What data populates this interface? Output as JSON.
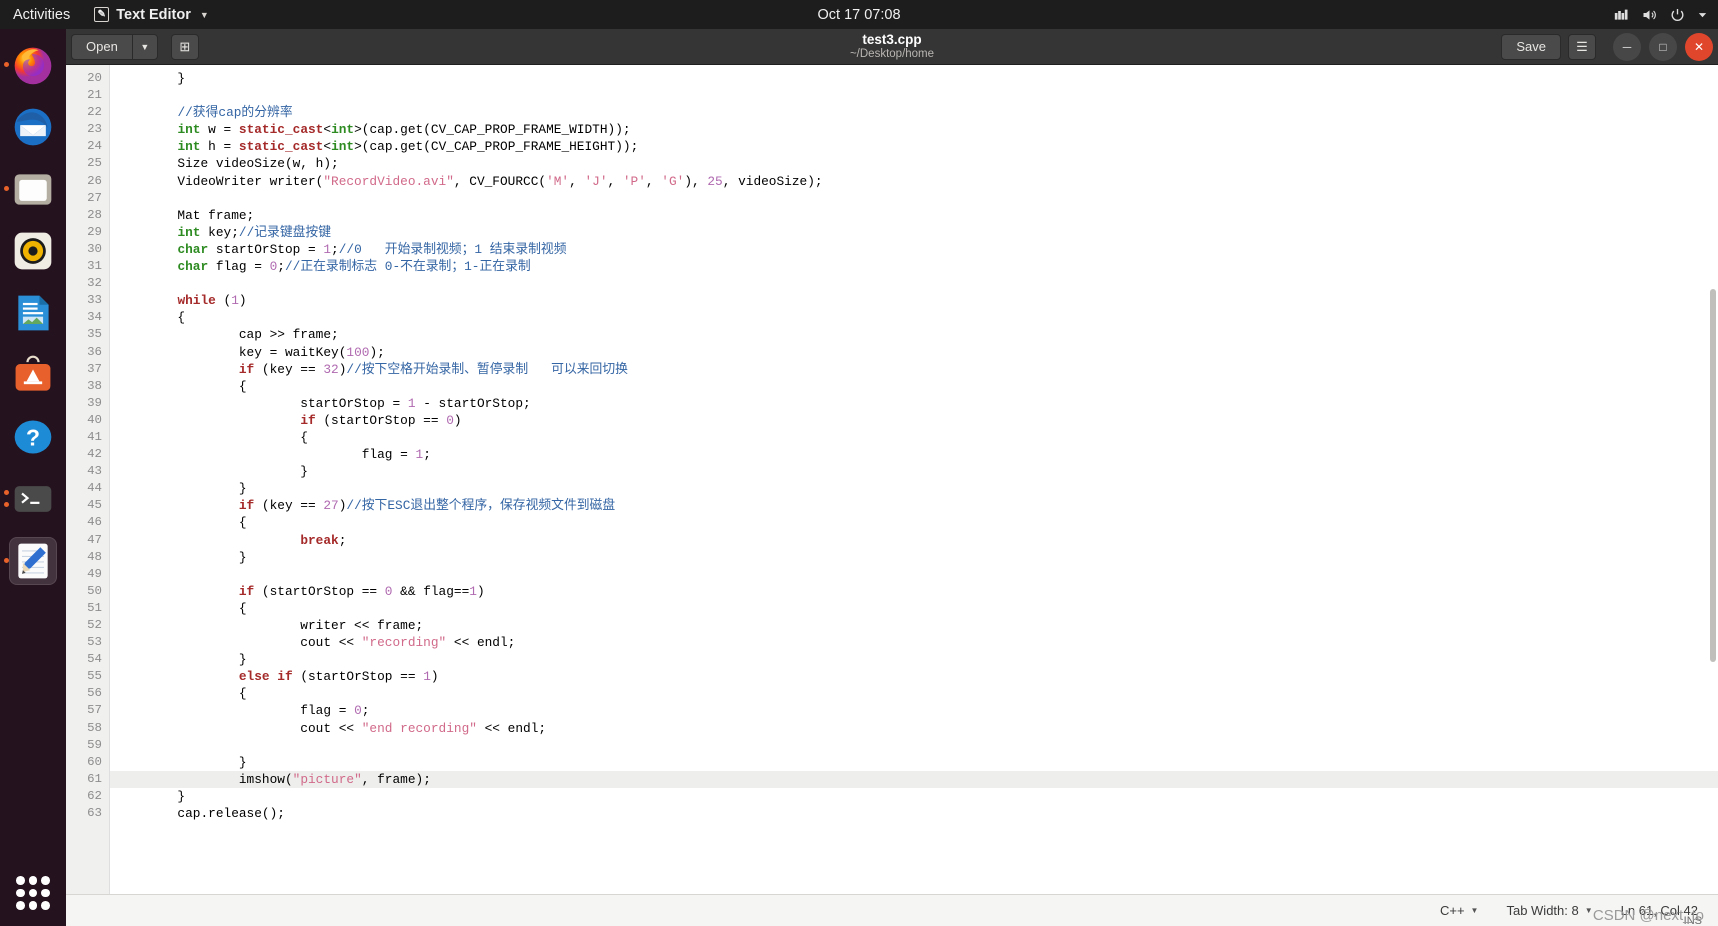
{
  "topbar": {
    "activities": "Activities",
    "app_name": "Text Editor",
    "app_icon": "pencil-icon",
    "dropdown_icon": "chevron-down-icon",
    "clock": "Oct 17  07:08",
    "indicators": [
      "network-icon",
      "volume-icon",
      "power-icon",
      "chevron-down-icon"
    ]
  },
  "dock": {
    "items": [
      {
        "name": "firefox",
        "running": true
      },
      {
        "name": "thunderbird",
        "running": false
      },
      {
        "name": "files",
        "running": true
      },
      {
        "name": "rhythmbox",
        "running": false
      },
      {
        "name": "libreoffice-writer",
        "running": false
      },
      {
        "name": "ubuntu-software",
        "running": false
      },
      {
        "name": "help",
        "running": false
      },
      {
        "name": "terminal",
        "running": true
      },
      {
        "name": "text-editor",
        "running": true,
        "active": true
      }
    ],
    "show_applications": "show-applications-icon"
  },
  "window": {
    "open_label": "Open",
    "open_dropdown_icon": "chevron-down-icon",
    "new_document_icon": "new-document-icon",
    "title": "test3.cpp",
    "subtitle": "~/Desktop/home",
    "save_label": "Save",
    "menu_icon": "hamburger-menu-icon",
    "minimize_icon": "minimize-icon",
    "maximize_icon": "maximize-icon",
    "close_icon": "close-icon"
  },
  "statusbar": {
    "language": "C++",
    "language_arrow": "chevron-down-icon",
    "tab_width": "Tab Width: 8",
    "tab_width_arrow": "chevron-down-icon",
    "position": "Ln 61, Col 42",
    "insert_mode": "INS",
    "watermark": "CSDN @next_to"
  },
  "editor": {
    "first_line": 20,
    "current_line": 61,
    "lines": [
      {
        "n": 20,
        "tokens": [
          {
            "t": "        }"
          }
        ]
      },
      {
        "n": 21,
        "tokens": [
          {
            "t": ""
          }
        ]
      },
      {
        "n": 22,
        "tokens": [
          {
            "t": "        "
          },
          {
            "t": "//获得cap的分辨率",
            "c": "com"
          }
        ]
      },
      {
        "n": 23,
        "tokens": [
          {
            "t": "        "
          },
          {
            "t": "int",
            "c": "typ"
          },
          {
            "t": " w = "
          },
          {
            "t": "static_cast",
            "c": "kw"
          },
          {
            "t": "<"
          },
          {
            "t": "int",
            "c": "typ"
          },
          {
            "t": ">(cap.get(CV_CAP_PROP_FRAME_WIDTH));"
          }
        ]
      },
      {
        "n": 24,
        "tokens": [
          {
            "t": "        "
          },
          {
            "t": "int",
            "c": "typ"
          },
          {
            "t": " h = "
          },
          {
            "t": "static_cast",
            "c": "kw"
          },
          {
            "t": "<"
          },
          {
            "t": "int",
            "c": "typ"
          },
          {
            "t": ">(cap.get(CV_CAP_PROP_FRAME_HEIGHT));"
          }
        ]
      },
      {
        "n": 25,
        "tokens": [
          {
            "t": "        Size videoSize(w, h);"
          }
        ]
      },
      {
        "n": 26,
        "tokens": [
          {
            "t": "        VideoWriter writer("
          },
          {
            "t": "\"RecordVideo.avi\"",
            "c": "str"
          },
          {
            "t": ", CV_FOURCC("
          },
          {
            "t": "'M'",
            "c": "str"
          },
          {
            "t": ", "
          },
          {
            "t": "'J'",
            "c": "str"
          },
          {
            "t": ", "
          },
          {
            "t": "'P'",
            "c": "str"
          },
          {
            "t": ", "
          },
          {
            "t": "'G'",
            "c": "str"
          },
          {
            "t": "), "
          },
          {
            "t": "25",
            "c": "num"
          },
          {
            "t": ", videoSize);"
          }
        ]
      },
      {
        "n": 27,
        "tokens": [
          {
            "t": ""
          }
        ]
      },
      {
        "n": 28,
        "tokens": [
          {
            "t": "        Mat frame;"
          }
        ]
      },
      {
        "n": 29,
        "tokens": [
          {
            "t": "        "
          },
          {
            "t": "int",
            "c": "typ"
          },
          {
            "t": " key;"
          },
          {
            "t": "//记录键盘按键",
            "c": "com"
          }
        ]
      },
      {
        "n": 30,
        "tokens": [
          {
            "t": "        "
          },
          {
            "t": "char",
            "c": "typ"
          },
          {
            "t": " startOrStop = "
          },
          {
            "t": "1",
            "c": "num"
          },
          {
            "t": ";"
          },
          {
            "t": "//0   开始录制视频；1 结束录制视频",
            "c": "com"
          }
        ]
      },
      {
        "n": 31,
        "tokens": [
          {
            "t": "        "
          },
          {
            "t": "char",
            "c": "typ"
          },
          {
            "t": " flag = "
          },
          {
            "t": "0",
            "c": "num"
          },
          {
            "t": ";"
          },
          {
            "t": "//正在录制标志 0-不在录制；1-正在录制",
            "c": "com"
          }
        ]
      },
      {
        "n": 32,
        "tokens": [
          {
            "t": ""
          }
        ]
      },
      {
        "n": 33,
        "tokens": [
          {
            "t": "        "
          },
          {
            "t": "while",
            "c": "kw"
          },
          {
            "t": " ("
          },
          {
            "t": "1",
            "c": "num"
          },
          {
            "t": ")"
          }
        ]
      },
      {
        "n": 34,
        "tokens": [
          {
            "t": "        {"
          }
        ]
      },
      {
        "n": 35,
        "tokens": [
          {
            "t": "                cap >> frame;"
          }
        ]
      },
      {
        "n": 36,
        "tokens": [
          {
            "t": "                key = waitKey("
          },
          {
            "t": "100",
            "c": "num"
          },
          {
            "t": ");"
          }
        ]
      },
      {
        "n": 37,
        "tokens": [
          {
            "t": "                "
          },
          {
            "t": "if",
            "c": "kw"
          },
          {
            "t": " (key == "
          },
          {
            "t": "32",
            "c": "num"
          },
          {
            "t": ")"
          },
          {
            "t": "//按下空格开始录制、暂停录制   可以来回切换",
            "c": "com"
          }
        ]
      },
      {
        "n": 38,
        "tokens": [
          {
            "t": "                {"
          }
        ]
      },
      {
        "n": 39,
        "tokens": [
          {
            "t": "                        startOrStop = "
          },
          {
            "t": "1",
            "c": "num"
          },
          {
            "t": " - startOrStop;"
          }
        ]
      },
      {
        "n": 40,
        "tokens": [
          {
            "t": "                        "
          },
          {
            "t": "if",
            "c": "kw"
          },
          {
            "t": " (startOrStop == "
          },
          {
            "t": "0",
            "c": "num"
          },
          {
            "t": ")"
          }
        ]
      },
      {
        "n": 41,
        "tokens": [
          {
            "t": "                        {"
          }
        ]
      },
      {
        "n": 42,
        "tokens": [
          {
            "t": "                                flag = "
          },
          {
            "t": "1",
            "c": "num"
          },
          {
            "t": ";"
          }
        ]
      },
      {
        "n": 43,
        "tokens": [
          {
            "t": "                        }"
          }
        ]
      },
      {
        "n": 44,
        "tokens": [
          {
            "t": "                }"
          }
        ]
      },
      {
        "n": 45,
        "tokens": [
          {
            "t": "                "
          },
          {
            "t": "if",
            "c": "kw"
          },
          {
            "t": " (key == "
          },
          {
            "t": "27",
            "c": "num"
          },
          {
            "t": ")"
          },
          {
            "t": "//按下ESC退出整个程序，保存视频文件到磁盘",
            "c": "com"
          }
        ]
      },
      {
        "n": 46,
        "tokens": [
          {
            "t": "                {"
          }
        ]
      },
      {
        "n": 47,
        "tokens": [
          {
            "t": "                        "
          },
          {
            "t": "break",
            "c": "kw"
          },
          {
            "t": ";"
          }
        ]
      },
      {
        "n": 48,
        "tokens": [
          {
            "t": "                }"
          }
        ]
      },
      {
        "n": 49,
        "tokens": [
          {
            "t": ""
          }
        ]
      },
      {
        "n": 50,
        "tokens": [
          {
            "t": "                "
          },
          {
            "t": "if",
            "c": "kw"
          },
          {
            "t": " (startOrStop == "
          },
          {
            "t": "0",
            "c": "num"
          },
          {
            "t": " && flag=="
          },
          {
            "t": "1",
            "c": "num"
          },
          {
            "t": ")"
          }
        ]
      },
      {
        "n": 51,
        "tokens": [
          {
            "t": "                {"
          }
        ]
      },
      {
        "n": 52,
        "tokens": [
          {
            "t": "                        writer << frame;"
          }
        ]
      },
      {
        "n": 53,
        "tokens": [
          {
            "t": "                        cout << "
          },
          {
            "t": "\"recording\"",
            "c": "str"
          },
          {
            "t": " << endl;"
          }
        ]
      },
      {
        "n": 54,
        "tokens": [
          {
            "t": "                }"
          }
        ]
      },
      {
        "n": 55,
        "tokens": [
          {
            "t": "                "
          },
          {
            "t": "else if",
            "c": "kw"
          },
          {
            "t": " (startOrStop == "
          },
          {
            "t": "1",
            "c": "num"
          },
          {
            "t": ")"
          }
        ]
      },
      {
        "n": 56,
        "tokens": [
          {
            "t": "                {"
          }
        ]
      },
      {
        "n": 57,
        "tokens": [
          {
            "t": "                        flag = "
          },
          {
            "t": "0",
            "c": "num"
          },
          {
            "t": ";"
          }
        ]
      },
      {
        "n": 58,
        "tokens": [
          {
            "t": "                        cout << "
          },
          {
            "t": "\"end recording\"",
            "c": "str"
          },
          {
            "t": " << endl;"
          }
        ]
      },
      {
        "n": 59,
        "tokens": [
          {
            "t": ""
          }
        ]
      },
      {
        "n": 60,
        "tokens": [
          {
            "t": "                }"
          }
        ]
      },
      {
        "n": 61,
        "tokens": [
          {
            "t": "                imshow("
          },
          {
            "t": "\"picture\"",
            "c": "str"
          },
          {
            "t": ", frame);"
          }
        ]
      },
      {
        "n": 62,
        "tokens": [
          {
            "t": "        }"
          }
        ]
      },
      {
        "n": 63,
        "tokens": [
          {
            "t": "        cap.release();"
          }
        ]
      }
    ]
  }
}
